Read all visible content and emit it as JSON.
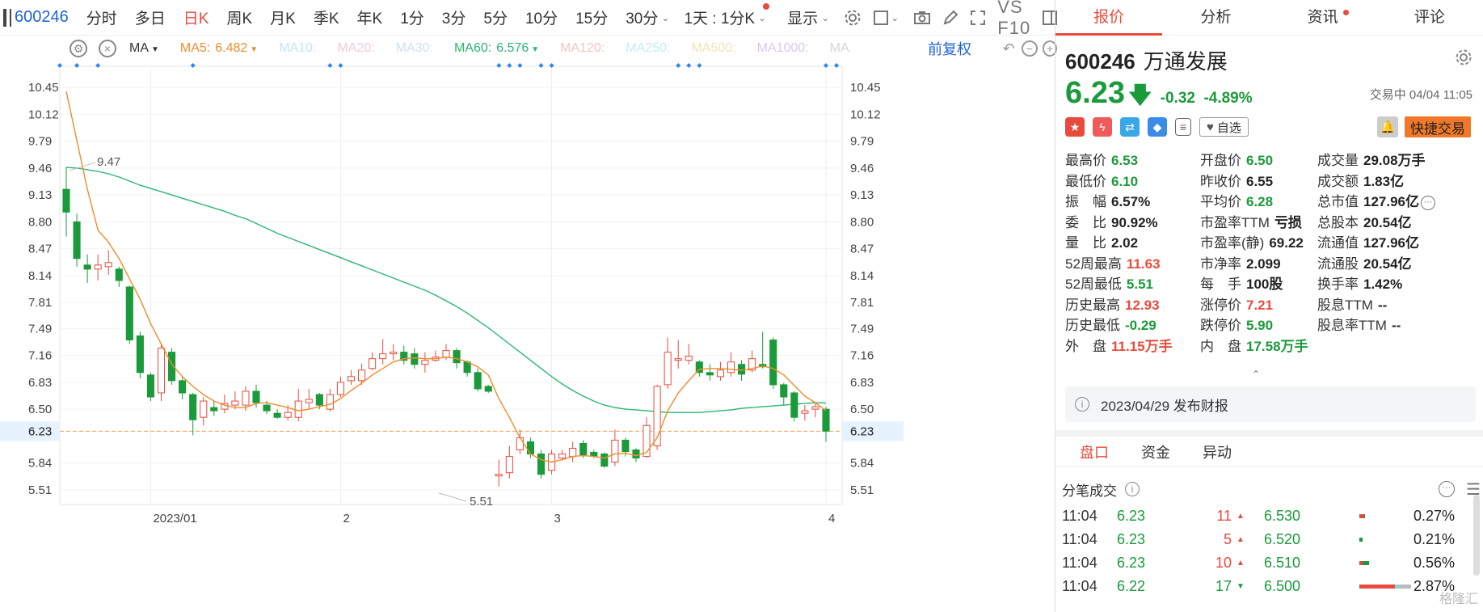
{
  "toolbar": {
    "code": "600246",
    "periods": [
      "分时",
      "多日",
      "日K",
      "周K",
      "月K",
      "季K",
      "年K",
      "1分",
      "3分",
      "5分",
      "10分",
      "15分",
      "30分"
    ],
    "active_period": "日K",
    "interval": "1天 : 1分K",
    "display": "显示",
    "vs_label": "VS F10"
  },
  "ma_bar": {
    "selector": "MA",
    "items": [
      {
        "label": "MA5:",
        "value": "6.482",
        "color": "#f08c28",
        "shown": true
      },
      {
        "label": "MA10:",
        "value": "",
        "color": "#c5e3f7",
        "shown": false
      },
      {
        "label": "MA20:",
        "value": "",
        "color": "#f5c9df",
        "shown": false
      },
      {
        "label": "MA30:",
        "value": "",
        "color": "#cfe0f3",
        "shown": false
      },
      {
        "label": "MA60:",
        "value": "6.576",
        "color": "#2bb673",
        "shown": true
      },
      {
        "label": "MA120:",
        "value": "",
        "color": "#f5c3c3",
        "shown": false
      },
      {
        "label": "MA250:",
        "value": "",
        "color": "#c6ecf3",
        "shown": false
      },
      {
        "label": "MA500:",
        "value": "",
        "color": "#f5e3b8",
        "shown": false
      },
      {
        "label": "MA1000:",
        "value": "",
        "color": "#dac7f0",
        "shown": false
      },
      {
        "label": "MA",
        "value": "",
        "color": "#d6d6d6",
        "shown": false
      }
    ],
    "adjust": "前复权"
  },
  "chart_data": {
    "type": "candlestick",
    "y_ticks": [
      "10.45",
      "10.12",
      "9.79",
      "9.46",
      "9.13",
      "8.80",
      "8.47",
      "8.14",
      "7.81",
      "7.49",
      "7.16",
      "6.83",
      "6.50",
      "6.23",
      "5.84",
      "5.51"
    ],
    "ylim": [
      5.33,
      10.71
    ],
    "x_labels": [
      {
        "label": "2023/01",
        "index": 8
      },
      {
        "label": "2",
        "index": 26
      },
      {
        "label": "3",
        "index": 46
      },
      {
        "label": "4",
        "index": 72
      }
    ],
    "current_price_line": "6.23",
    "annotations": [
      {
        "text": "9.47",
        "index": 0,
        "price": 9.47
      },
      {
        "text": "5.51",
        "index": 35,
        "price": 5.51
      }
    ],
    "candles": [
      [
        9.2,
        8.92,
        9.47,
        8.62
      ],
      [
        8.8,
        8.35,
        8.9,
        8.25
      ],
      [
        8.27,
        8.22,
        8.4,
        8.05
      ],
      [
        8.22,
        8.27,
        8.4,
        8.08
      ],
      [
        8.25,
        8.3,
        8.45,
        8.15
      ],
      [
        8.22,
        8.08,
        8.25,
        8.0
      ],
      [
        8.0,
        7.35,
        8.02,
        7.3
      ],
      [
        7.4,
        6.95,
        7.45,
        6.88
      ],
      [
        6.92,
        6.65,
        6.95,
        6.6
      ],
      [
        6.7,
        7.25,
        7.3,
        6.6
      ],
      [
        7.2,
        6.85,
        7.25,
        6.8
      ],
      [
        6.85,
        6.7,
        6.9,
        6.62
      ],
      [
        6.68,
        6.37,
        6.7,
        6.18
      ],
      [
        6.4,
        6.6,
        6.65,
        6.3
      ],
      [
        6.52,
        6.48,
        6.6,
        6.42
      ],
      [
        6.5,
        6.57,
        6.68,
        6.45
      ],
      [
        6.55,
        6.6,
        6.72,
        6.5
      ],
      [
        6.55,
        6.72,
        6.78,
        6.48
      ],
      [
        6.72,
        6.58,
        6.8,
        6.52
      ],
      [
        6.55,
        6.48,
        6.6,
        6.44
      ],
      [
        6.45,
        6.4,
        6.5,
        6.38
      ],
      [
        6.4,
        6.46,
        6.55,
        6.36
      ],
      [
        6.4,
        6.6,
        6.75,
        6.35
      ],
      [
        6.58,
        6.62,
        6.75,
        6.5
      ],
      [
        6.68,
        6.55,
        6.7,
        6.5
      ],
      [
        6.5,
        6.68,
        6.75,
        6.47
      ],
      [
        6.68,
        6.83,
        6.9,
        6.65
      ],
      [
        6.85,
        6.9,
        6.98,
        6.8
      ],
      [
        6.85,
        6.98,
        7.06,
        6.8
      ],
      [
        7.0,
        7.12,
        7.2,
        6.98
      ],
      [
        7.12,
        7.18,
        7.36,
        7.05
      ],
      [
        7.18,
        7.2,
        7.3,
        7.1
      ],
      [
        7.2,
        7.1,
        7.28,
        7.05
      ],
      [
        7.18,
        7.05,
        7.25,
        7.0
      ],
      [
        7.05,
        7.1,
        7.2,
        6.95
      ],
      [
        7.1,
        7.14,
        7.22,
        7.08
      ],
      [
        7.14,
        7.22,
        7.3,
        7.1
      ],
      [
        7.22,
        7.07,
        7.25,
        7.0
      ],
      [
        7.08,
        6.95,
        7.1,
        6.9
      ],
      [
        6.95,
        6.75,
        7.0,
        6.72
      ],
      [
        6.78,
        6.72,
        6.8,
        6.7
      ],
      [
        5.68,
        5.7,
        5.88,
        5.55
      ],
      [
        5.72,
        5.92,
        6.05,
        5.65
      ],
      [
        6.0,
        6.15,
        6.25,
        5.95
      ],
      [
        6.1,
        5.95,
        6.15,
        5.9
      ],
      [
        5.95,
        5.7,
        6.0,
        5.65
      ],
      [
        5.75,
        5.95,
        6.0,
        5.7
      ],
      [
        5.9,
        5.95,
        6.0,
        5.88
      ],
      [
        5.92,
        6.02,
        6.1,
        5.85
      ],
      [
        6.08,
        5.94,
        6.12,
        5.9
      ],
      [
        5.97,
        5.92,
        6.0,
        5.9
      ],
      [
        5.95,
        5.8,
        5.97,
        5.78
      ],
      [
        5.85,
        6.12,
        6.25,
        5.8
      ],
      [
        6.12,
        5.98,
        6.15,
        5.92
      ],
      [
        6.0,
        5.9,
        6.02,
        5.85
      ],
      [
        5.92,
        6.3,
        6.4,
        5.9
      ],
      [
        6.05,
        6.78,
        6.8,
        6.0
      ],
      [
        6.8,
        7.2,
        7.38,
        6.75
      ],
      [
        7.1,
        7.12,
        7.35,
        7.0
      ],
      [
        7.1,
        7.15,
        7.3,
        7.05
      ],
      [
        7.08,
        6.95,
        7.1,
        6.9
      ],
      [
        6.95,
        6.92,
        7.05,
        6.85
      ],
      [
        6.9,
        6.98,
        7.08,
        6.85
      ],
      [
        6.95,
        7.08,
        7.2,
        6.9
      ],
      [
        7.05,
        6.93,
        7.1,
        6.85
      ],
      [
        6.98,
        7.12,
        7.22,
        6.95
      ],
      [
        7.05,
        7.02,
        7.45,
        7.0
      ],
      [
        7.35,
        6.8,
        7.38,
        6.75
      ],
      [
        6.8,
        6.65,
        6.82,
        6.55
      ],
      [
        6.7,
        6.4,
        6.72,
        6.35
      ],
      [
        6.45,
        6.48,
        6.55,
        6.36
      ],
      [
        6.5,
        6.53,
        6.58,
        6.4
      ],
      [
        6.5,
        6.23,
        6.53,
        6.1
      ]
    ],
    "ma5": [
      10.4,
      9.8,
      9.2,
      8.7,
      8.55,
      8.35,
      8.1,
      7.85,
      7.55,
      7.3,
      7.05,
      6.9,
      6.78,
      6.68,
      6.6,
      6.55,
      6.52,
      6.52,
      6.57,
      6.58,
      6.55,
      6.52,
      6.48,
      6.5,
      6.53,
      6.56,
      6.63,
      6.73,
      6.82,
      6.92,
      7.0,
      7.08,
      7.12,
      7.13,
      7.12,
      7.12,
      7.14,
      7.12,
      7.08,
      7.02,
      6.92,
      6.63,
      6.4,
      6.15,
      5.95,
      5.88,
      5.85,
      5.88,
      5.92,
      5.93,
      5.92,
      5.9,
      5.95,
      5.96,
      5.93,
      5.97,
      6.15,
      6.48,
      6.7,
      6.85,
      6.99,
      7.0,
      7.0,
      6.99,
      6.98,
      7.0,
      7.03,
      7.0,
      6.92,
      6.79,
      6.66,
      6.58,
      6.48
    ],
    "ma60": [
      9.47,
      9.46,
      9.44,
      9.42,
      9.39,
      9.35,
      9.3,
      9.25,
      9.21,
      9.17,
      9.13,
      9.09,
      9.05,
      9.01,
      8.97,
      8.93,
      8.88,
      8.84,
      8.78,
      8.72,
      8.66,
      8.61,
      8.56,
      8.51,
      8.46,
      8.41,
      8.36,
      8.31,
      8.26,
      8.21,
      8.16,
      8.11,
      8.06,
      8.01,
      7.96,
      7.9,
      7.83,
      7.76,
      7.68,
      7.59,
      7.5,
      7.4,
      7.3,
      7.2,
      7.1,
      7.0,
      6.9,
      6.81,
      6.73,
      6.66,
      6.6,
      6.55,
      6.52,
      6.5,
      6.49,
      6.48,
      6.47,
      6.46,
      6.46,
      6.46,
      6.46,
      6.47,
      6.48,
      6.49,
      6.51,
      6.52,
      6.53,
      6.54,
      6.55,
      6.56,
      6.57,
      6.58,
      6.576
    ],
    "colors": {
      "up": "#e84b3c",
      "down": "#1a9a3a",
      "ma5": "#f08c28",
      "ma60": "#2bb673",
      "price_line": "#f2a04a",
      "current_bg": "#e6f2fd",
      "marker": "#2e84f0"
    },
    "markers_idx": [
      0,
      1,
      3,
      12,
      25,
      26,
      41,
      42,
      43,
      45,
      46,
      58,
      59,
      60,
      72,
      73
    ]
  },
  "right_panel": {
    "tabs": [
      "报价",
      "分析",
      "资讯",
      "评论"
    ],
    "active_tab": "报价",
    "code": "600246",
    "name": "万通发展",
    "price": "6.23",
    "change": "-0.32",
    "change_pct": "-4.89%",
    "status_time": "交易中 04/04 11:05",
    "watch_label": "自选",
    "quick_trade": "快捷交易",
    "stats": [
      [
        {
          "l": "最高价",
          "v": "6.53",
          "c": "grn"
        },
        {
          "l": "开盘价",
          "v": "6.50",
          "c": "grn"
        },
        {
          "l": "成交量",
          "v": "29.08万手",
          "c": "blk"
        }
      ],
      [
        {
          "l": "最低价",
          "v": "6.10",
          "c": "grn"
        },
        {
          "l": "昨收价",
          "v": "6.55",
          "c": "blk"
        },
        {
          "l": "成交额",
          "v": "1.83亿",
          "c": "blk"
        }
      ],
      [
        {
          "l": "振　幅",
          "v": "6.57%",
          "c": "blk"
        },
        {
          "l": "平均价",
          "v": "6.28",
          "c": "grn"
        },
        {
          "l": "总市值",
          "v": "127.96亿",
          "c": "blk"
        }
      ],
      [
        {
          "l": "委　比",
          "v": "90.92%",
          "c": "blk"
        },
        {
          "l": "市盈率TTM",
          "v": "亏损",
          "c": "blk"
        },
        {
          "l": "总股本",
          "v": "20.54亿",
          "c": "blk"
        }
      ],
      [
        {
          "l": "量　比",
          "v": "2.02",
          "c": "blk"
        },
        {
          "l": "市盈率(静)",
          "v": "69.22",
          "c": "blk"
        },
        {
          "l": "流通值",
          "v": "127.96亿",
          "c": "blk"
        }
      ],
      [
        {
          "l": "52周最高",
          "v": "11.63",
          "c": "red"
        },
        {
          "l": "市净率",
          "v": "2.099",
          "c": "blk"
        },
        {
          "l": "流通股",
          "v": "20.54亿",
          "c": "blk"
        }
      ],
      [
        {
          "l": "52周最低",
          "v": "5.51",
          "c": "grn"
        },
        {
          "l": "每　手",
          "v": "100股",
          "c": "blk"
        },
        {
          "l": "换手率",
          "v": "1.42%",
          "c": "blk"
        }
      ],
      [
        {
          "l": "历史最高",
          "v": "12.93",
          "c": "red"
        },
        {
          "l": "涨停价",
          "v": "7.21",
          "c": "red"
        },
        {
          "l": "股息TTM",
          "v": "--",
          "c": "blk"
        }
      ],
      [
        {
          "l": "历史最低",
          "v": "-0.29",
          "c": "grn"
        },
        {
          "l": "跌停价",
          "v": "5.90",
          "c": "grn"
        },
        {
          "l": "股息率TTM",
          "v": "--",
          "c": "blk"
        }
      ],
      [
        {
          "l": "外　盘",
          "v": "11.15万手",
          "c": "red"
        },
        {
          "l": "内　盘",
          "v": "17.58万手",
          "c": "grn"
        },
        {
          "l": "",
          "v": "",
          "c": "blk"
        }
      ]
    ],
    "report": "2023/04/29  发布财报",
    "subtabs": [
      "盘口",
      "资金",
      "异动"
    ],
    "active_subtab": "盘口",
    "ticks_title": "分笔成交",
    "ticks": [
      {
        "time": "11:04",
        "price": "6.23",
        "vol": "11",
        "dir": "up",
        "p2": "6.530",
        "pct": "0.27%",
        "bar_red": 4,
        "bar_grn": 0
      },
      {
        "time": "11:04",
        "price": "6.23",
        "vol": "5",
        "dir": "up",
        "p2": "6.520",
        "pct": "0.21%",
        "bar_red": 0,
        "bar_grn": 2
      },
      {
        "time": "11:04",
        "price": "6.23",
        "vol": "10",
        "dir": "up",
        "p2": "6.510",
        "pct": "0.56%",
        "bar_red": 3,
        "bar_grn": 5
      },
      {
        "time": "11:04",
        "price": "6.22",
        "vol": "17",
        "dir": "down",
        "p2": "6.500",
        "pct": "2.87%",
        "bar_red": 36,
        "bar_grn": 6
      }
    ],
    "watermark": "格隆汇"
  }
}
